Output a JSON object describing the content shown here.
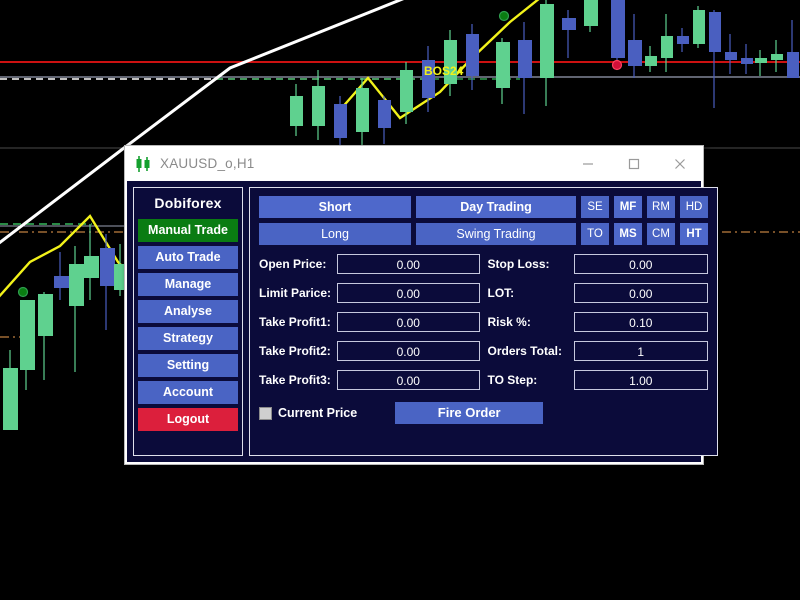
{
  "window": {
    "title": "XAUUSD_o,H1",
    "icon": "candlestick-icon",
    "controls": {
      "minimize": "—",
      "maximize": "□",
      "close": "✕"
    }
  },
  "sidebar": {
    "brand": "Dobiforex",
    "items": [
      {
        "label": "Manual Trade",
        "state": "active"
      },
      {
        "label": "Auto Trade",
        "state": "normal"
      },
      {
        "label": "Manage",
        "state": "normal"
      },
      {
        "label": "Analyse",
        "state": "normal"
      },
      {
        "label": "Strategy",
        "state": "normal"
      },
      {
        "label": "Setting",
        "state": "normal"
      },
      {
        "label": "Account",
        "state": "normal"
      },
      {
        "label": "Logout",
        "state": "danger"
      }
    ]
  },
  "toolbar": {
    "row1": {
      "direction": "Short",
      "style": "Day Trading",
      "toggles": [
        "SE",
        "MF",
        "RM",
        "HD"
      ]
    },
    "row2": {
      "direction": "Long",
      "style": "Swing Trading",
      "toggles": [
        "TO",
        "MS",
        "CM",
        "HT"
      ]
    }
  },
  "form": {
    "left": [
      {
        "label": "Open Price:",
        "value": "0.00"
      },
      {
        "label": "Limit Parice:",
        "value": "0.00"
      },
      {
        "label": "Take Profit1:",
        "value": "0.00"
      },
      {
        "label": "Take Profit2:",
        "value": "0.00"
      },
      {
        "label": "Take Profit3:",
        "value": "0.00"
      }
    ],
    "right": [
      {
        "label": "Stop Loss:",
        "value": "0.00"
      },
      {
        "label": "LOT:",
        "value": "0.00"
      },
      {
        "label": "Risk %:",
        "value": "0.10"
      },
      {
        "label": "Orders Total:",
        "value": "1"
      },
      {
        "label": "TO Step:",
        "value": "1.00"
      }
    ]
  },
  "bottom": {
    "checkbox_label": "Current Price",
    "checkbox_checked": false,
    "fire_label": "Fire Order"
  },
  "chart": {
    "symbol_label": "BOS24",
    "background": "#000000",
    "colors": {
      "bull_candle": "#5fd18f",
      "bear_candle": "#4a5fc0",
      "resistance_line": "#cc1111",
      "level_line": "#9aa0b5",
      "bos_dashed": "#ffffff",
      "support_dashed": "#2f9e4f",
      "trendline": "#ffffff",
      "zigzag": "#f2f21a",
      "fib_dashed": "#c08040",
      "buy_dot": "#0a7c12",
      "sell_dot": "#d01038"
    }
  }
}
